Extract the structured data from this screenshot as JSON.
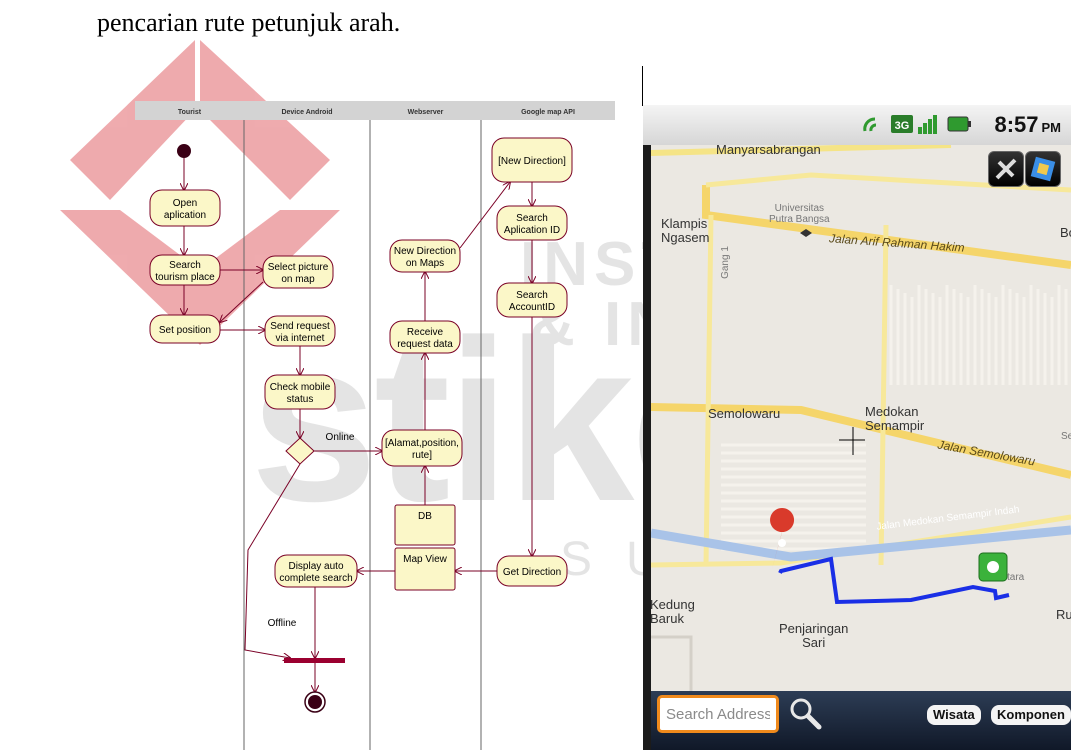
{
  "document": {
    "text_line": "pencarian rute petunjuk arah."
  },
  "watermark": {
    "line1": "INSTITUT BISNIS",
    "line2": "& INFORMATIKA",
    "brand": "stikom",
    "city": "SURABAYA",
    "colors": {
      "red": "#d9363e",
      "gray": "#b3b3b3"
    }
  },
  "diagram": {
    "lanes": [
      "Tourist",
      "Device Android",
      "Webserver",
      "Google map API"
    ],
    "nodes": {
      "open_app": "Open|aplication",
      "search_tourism": "Search|tourism place",
      "set_position": "Set position",
      "select_picture": "Select picture|on map",
      "send_request": "Send request|via internet",
      "check_mobile": "Check mobile|status",
      "display_auto": "Display auto|complete search",
      "new_direction_maps": "New Direction|on Maps",
      "receive_request": "Receive|request data",
      "alamat": "[Alamat,position,|rute]",
      "db": "DB",
      "map_view": "Map View",
      "new_direction": "[New Direction]",
      "search_app_id": "Search|Aplication ID",
      "search_account_id": "Search|AccountID",
      "get_direction": "Get Direction"
    },
    "guards": {
      "online": "Online",
      "offline": "Offline"
    },
    "colors": {
      "node_fill": "#fbf7c8",
      "node_stroke": "#7a0026",
      "bar": "#9b0030"
    }
  },
  "phone": {
    "clock": "8:57",
    "ampm": "PM",
    "map_labels": {
      "manyarsabrangan": "Manyarsabrangan",
      "universitas": "Universitas|Putra Bangsa",
      "klampis": "Klampis|Ngasem",
      "jalan_arif": "Jalan Arif Rahman Hakim",
      "gang": "Gang 1",
      "semolowaru": "Semolowaru",
      "medokan": "Medokan|Semampir",
      "jalan_semolowaru": "Jalan Semolowaru",
      "jalan_medokan": "Jalan Medokan Semampir Indah",
      "kedung": "Kedung|Baruk",
      "penjaringan": "Penjaringan|Sari",
      "bok": "Bok",
      "sek": "Sek",
      "ru": "Ru",
      "tara": "tara"
    },
    "search_placeholder": "Search Address",
    "buttons": {
      "wisata": "Wisata",
      "komponen": "Komponen"
    },
    "route_color": "#1a2fe6"
  }
}
